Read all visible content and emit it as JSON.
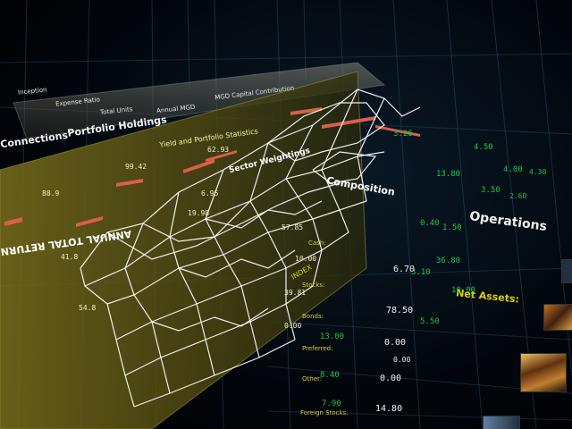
{
  "panel_headers": [
    "Connections",
    "Portfolio Holdings",
    "Yield and Portfolio Statistics",
    "Sector Weightings",
    "Composition"
  ],
  "column_headers": [
    "Inception",
    "Expense Ratio",
    "Total Units",
    "Annual MGD",
    "MGD Capital Contribution"
  ],
  "operations": {
    "title": "Operations",
    "net_assets_label": "Net Assets:",
    "rows": [
      {
        "label": "Cash:",
        "value": "6.70"
      },
      {
        "label": "Stocks:",
        "value": "78.50"
      },
      {
        "label": "Bonds:",
        "value": "0.00"
      },
      {
        "label": "Preferred:",
        "value": "0.00"
      },
      {
        "label": "Other:",
        "value": "0.00"
      },
      {
        "label": "Foreign Stocks:",
        "value": "14.80"
      }
    ],
    "green_values": [
      "13.00",
      "8.40",
      "7.90",
      "5.50",
      "3.10"
    ],
    "right_numbers": [
      "4.00",
      "4.30",
      "3.50",
      "2.60",
      "0.40",
      "3.26",
      "1.50",
      "36.80",
      "10.00",
      "13.80",
      "4.50"
    ]
  },
  "left_panel_values": [
    "88.9",
    "99.42",
    "62.93",
    "41.8",
    "54.8",
    "6.95",
    "19.98",
    "57.85",
    "10.00",
    "39.81",
    "0.00"
  ],
  "side_labels": [
    "ANNUAL TOTAL RETURN",
    "INDEX"
  ],
  "colors": {
    "accent_green": "#1ec64a",
    "panel_yellow": "#6b6214",
    "bar_red": "#d9604a",
    "wire": "#ffffff"
  }
}
